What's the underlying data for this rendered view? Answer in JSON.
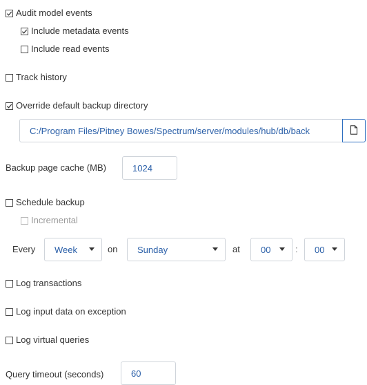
{
  "audit": {
    "audit_model_events": {
      "label": "Audit model events",
      "checked": true
    },
    "include_metadata_events": {
      "label": "Include metadata events",
      "checked": true
    },
    "include_read_events": {
      "label": "Include read events",
      "checked": false
    }
  },
  "track_history": {
    "label": "Track history",
    "checked": false
  },
  "override_backup_dir": {
    "label": "Override default backup directory",
    "checked": true,
    "path": "C:/Program Files/Pitney Bowes/Spectrum/server/modules/hub/db/back",
    "browse_icon": "file-icon"
  },
  "backup_page_cache": {
    "label": "Backup page cache (MB)",
    "value": "1024"
  },
  "schedule_backup": {
    "label": "Schedule backup",
    "checked": false,
    "incremental": {
      "label": "Incremental",
      "checked": false,
      "disabled": true
    },
    "every_label": "Every",
    "period": "Week",
    "on_label": "on",
    "day": "Sunday",
    "at_label": "at",
    "hour": "00",
    "time_separator": ":",
    "minute": "00"
  },
  "log_transactions": {
    "label": "Log transactions",
    "checked": false
  },
  "log_input_data": {
    "label": "Log input data on exception",
    "checked": false
  },
  "log_virtual_queries": {
    "label": "Log virtual queries",
    "checked": false
  },
  "query_timeout": {
    "label": "Query timeout (seconds)",
    "value": "60"
  },
  "colors": {
    "accent": "#2e6fc0",
    "value_text": "#2a5fa8",
    "border": "#cfd4da"
  }
}
